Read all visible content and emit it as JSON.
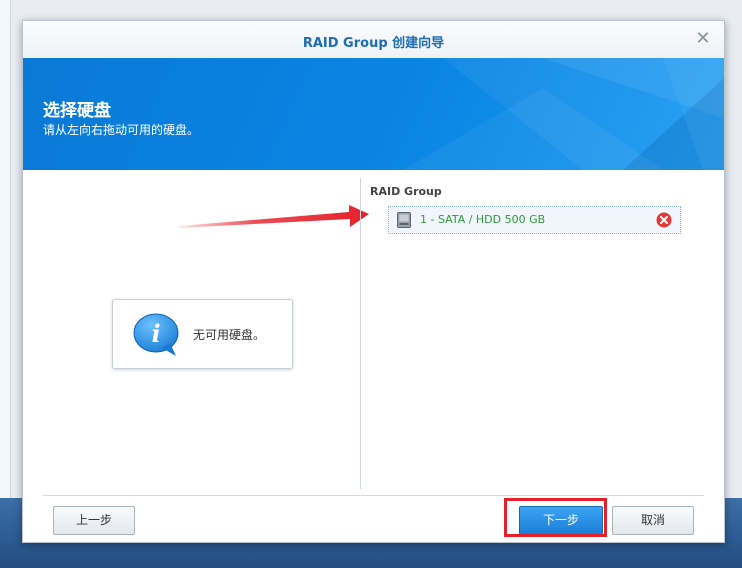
{
  "dialog": {
    "title": "RAID Group 创建向导",
    "close_icon": "close-icon"
  },
  "banner": {
    "title": "选择硬盘",
    "subtitle": "请从左向右拖动可用的硬盘。"
  },
  "available_disks": {
    "empty_message": "无可用硬盘。",
    "info_icon": "info-icon"
  },
  "raid_group": {
    "label": "RAID Group",
    "disks": [
      {
        "label": "1 - SATA / HDD 500 GB",
        "icon": "hdd-icon",
        "remove_icon": "remove-icon"
      }
    ]
  },
  "footer": {
    "prev_label": "上一步",
    "next_label": "下一步",
    "cancel_label": "取消"
  },
  "annotations": {
    "arrow_color": "#e5202a",
    "highlight_color": "#e5202a"
  },
  "colors": {
    "accent": "#0a85e4",
    "title": "#1d6cb8",
    "disk_text": "#2f9b3a"
  }
}
